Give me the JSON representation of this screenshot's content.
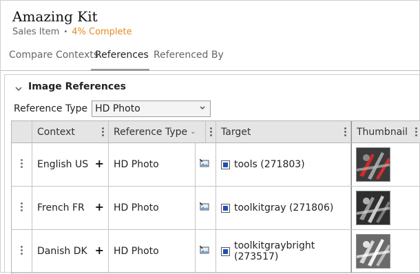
{
  "page": {
    "title": "Amazing Kit",
    "item_type": "Sales Item",
    "separator": "•",
    "completion": "4% Complete"
  },
  "tabs": [
    {
      "label": "Compare Contexts",
      "active": false
    },
    {
      "label": "References",
      "active": true
    },
    {
      "label": "Referenced By",
      "active": false
    }
  ],
  "section": {
    "title": "Image References",
    "reference_type_label": "Reference Type",
    "reference_type_value": "HD Photo"
  },
  "table": {
    "columns": {
      "context": "Context",
      "reference_type": "Reference Type",
      "target": "Target",
      "thumbnail": "Thumbnail"
    },
    "rows": [
      {
        "context": "English US",
        "reference_type": "HD Photo",
        "target": "tools (271803)",
        "thumbnail_style": "red"
      },
      {
        "context": "French FR",
        "reference_type": "HD Photo",
        "target": "toolkitgray (271806)",
        "thumbnail_style": "gray"
      },
      {
        "context": "Danish DK",
        "reference_type": "HD Photo",
        "target": "toolkitgraybright (273517)",
        "thumbnail_style": "bright"
      }
    ]
  },
  "colors": {
    "accent_progress": "#e58a1f",
    "target_icon_blue": "#1e4fb8",
    "header_bg": "#e5e5e5"
  }
}
